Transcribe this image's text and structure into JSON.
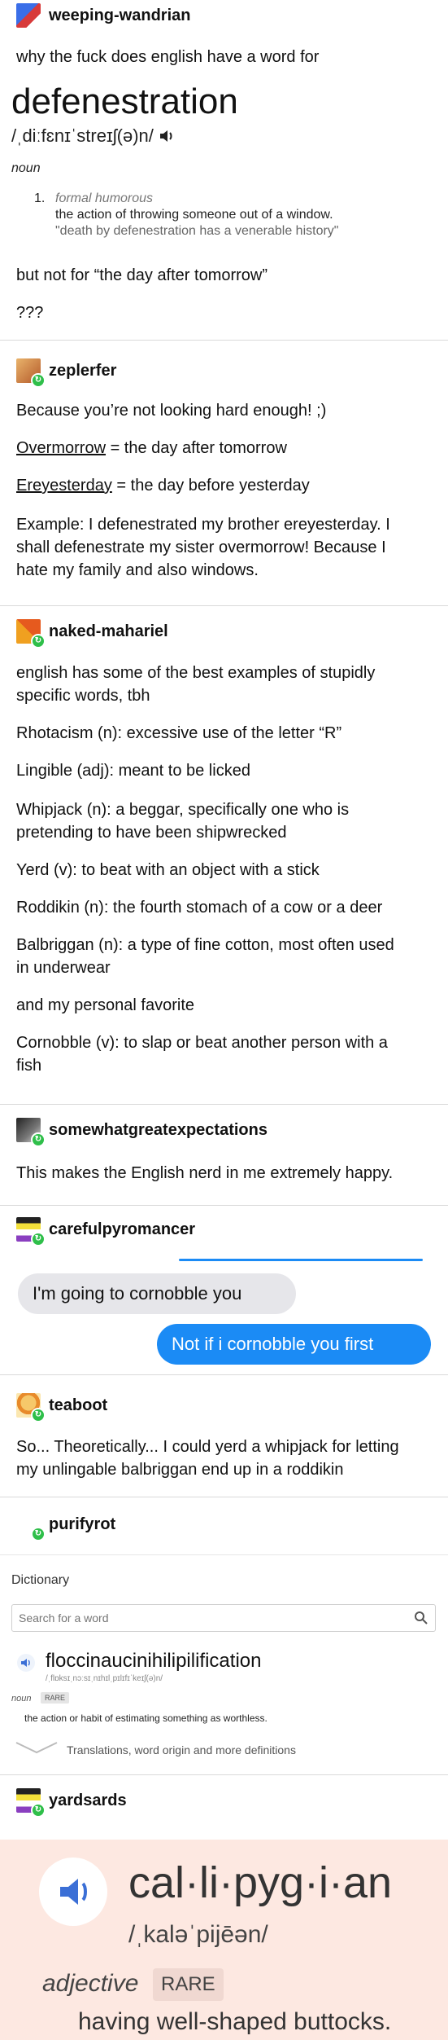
{
  "posts": {
    "p1": {
      "username": "weeping-wandrian",
      "line1": "why the fuck does english have a word for",
      "dict_word": "defenestration",
      "dict_pron": "/ˌdiːfɛnɪˈstreɪʃ(ə)n/",
      "dict_pos": "noun",
      "dict_num": "1.",
      "dict_register": "formal humorous",
      "dict_definition": "the action of throwing someone out of a window.",
      "dict_example": "\"death by defenestration has a venerable history\"",
      "line2": "but not for “the day after tomorrow”",
      "line3": "???"
    },
    "p2": {
      "username": "zeplerfer",
      "line1": "Because you’re not looking hard enough! ;)",
      "word1": "Overmorrow",
      "rest1": " = the day after tomorrow",
      "word2": "Ereyesterday",
      "rest2": " = the day before yesterday",
      "line4a": "Example: I defenestrated my brother ereyesterday. I",
      "line4b": "shall defenestrate my sister overmorrow! Because I",
      "line4c": "hate my family and also windows."
    },
    "p3": {
      "username": "naked-mahariel",
      "line1a": "english has some of the best examples of stupidly",
      "line1b": "specific words, tbh",
      "rhotacism": "Rhotacism (n): excessive use of the letter “R”",
      "lingible": "Lingible (adj): meant to be licked",
      "whipjack_a": "Whipjack (n): a beggar, specifically one who is",
      "whipjack_b": "pretending to have been shipwrecked",
      "yerd": "Yerd (v): to beat with an object with a stick",
      "roddikin": "Roddikin (n): the fourth stomach of a cow or a deer",
      "balbriggan_a": "Balbriggan (n): a type of fine cotton, most often used",
      "balbriggan_b": "in underwear",
      "favorite": "and my personal favorite",
      "cornobble_a": "Cornobble (v): to slap or beat another person with a",
      "cornobble_b": "fish"
    },
    "p4": {
      "username": "somewhatgreatexpectations",
      "line1": "This makes the English nerd in me extremely happy."
    },
    "p5": {
      "username": "carefulpyromancer",
      "msg_received": "I'm going to cornobble you",
      "msg_sent": "Not if i cornobble you first"
    },
    "p6": {
      "username": "teaboot",
      "line1": "So... Theoretically... I could yerd a whipjack for letting",
      "line2": "my unlingable balbriggan end up in a roddikin"
    },
    "p7": {
      "username": "purifyrot",
      "dict_title": "Dictionary",
      "search_placeholder": "Search for a word",
      "word": "floccinaucinihilipilification",
      "pron": "/ˌflɒksɪˌnɔːsɪˌnɪhɪlˌpɪlɪfɪˈkeɪʃ(ə)n/",
      "pos": "noun",
      "rare": "RARE",
      "definition": "the action or habit of estimating something as worthless.",
      "more": "Translations, word origin and more definitions"
    },
    "p8": {
      "username": "yardsards",
      "word": "cal·li·pyg·i·an",
      "pron": "/ˌkaləˈpijēən/",
      "pos": "adjective",
      "rare": "RARE",
      "definition": "having well-shaped buttocks."
    }
  },
  "colors": {
    "imessage_blue": "#1b8bf5",
    "imessage_gray": "#e6e6ea",
    "reblog_badge": "#2fbf4a",
    "card_pink": "#fde8e1"
  }
}
